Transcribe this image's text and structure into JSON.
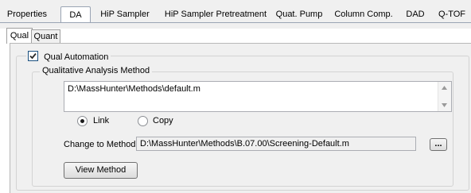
{
  "top_tabs": [
    {
      "label": "Properties",
      "selected": false
    },
    {
      "label": "DA",
      "selected": true
    },
    {
      "label": "HiP Sampler",
      "selected": false
    },
    {
      "label": "HiP Sampler Pretreatment",
      "selected": false
    },
    {
      "label": "Quat. Pump",
      "selected": false
    },
    {
      "label": "Column Comp.",
      "selected": false
    },
    {
      "label": "DAD",
      "selected": false
    },
    {
      "label": "Q-TOF",
      "selected": false
    }
  ],
  "sub_tabs": [
    {
      "label": "Qual",
      "selected": true
    },
    {
      "label": "Quant",
      "selected": false
    }
  ],
  "qual": {
    "automation_label": "Qual Automation",
    "automation_checked": true,
    "method_group_title": "Qualitative Analysis Method",
    "method_path": "D:\\MassHunter\\Methods\\default.m",
    "link_label": "Link",
    "copy_label": "Copy",
    "selected_mode": "Link",
    "change_label": "Change to Method:",
    "change_value": "D:\\MassHunter\\Methods\\B.07.00\\Screening-Default.m",
    "browse_label": "...",
    "view_button": "View Method"
  }
}
